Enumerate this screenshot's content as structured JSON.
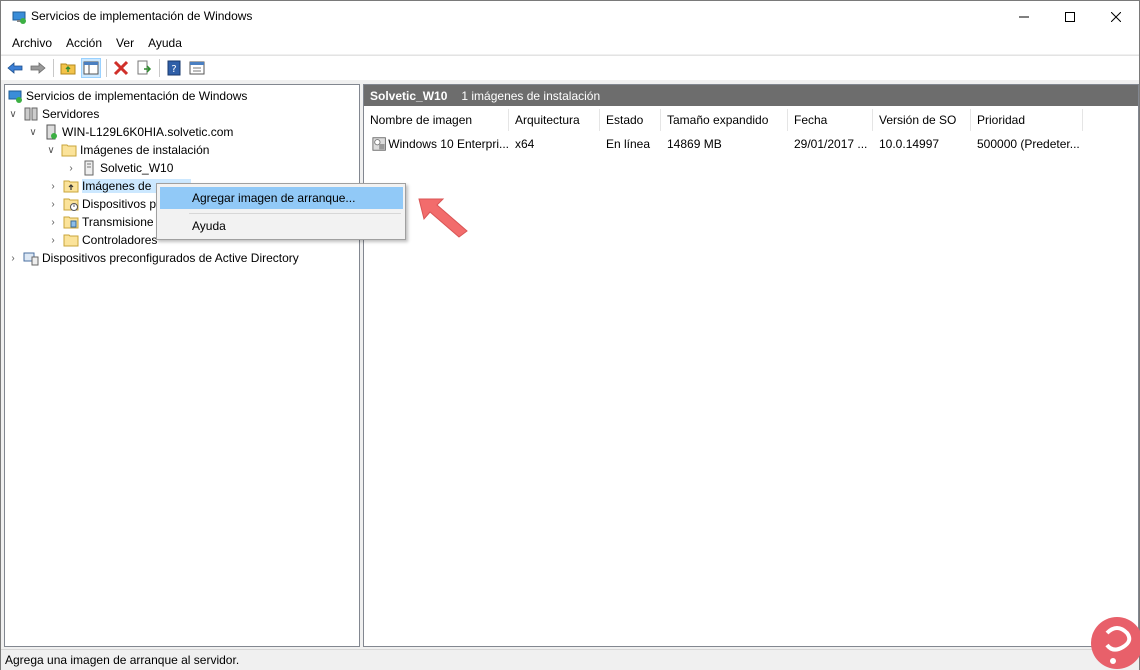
{
  "window": {
    "title": "Servicios de implementación de Windows"
  },
  "menu": [
    "Archivo",
    "Acción",
    "Ver",
    "Ayuda"
  ],
  "tree": {
    "root": "Servicios de implementación de Windows",
    "servers": "Servidores",
    "server": "WIN-L129L6K0HIA.solvetic.com",
    "install_images": "Imágenes de instalación",
    "group": "Solvetic_W10",
    "boot_images": "Imágenes de",
    "pending_devices": "Dispositivos p",
    "multicast": "Transmisione",
    "drivers": "Controladores",
    "ad_devices": "Dispositivos preconfigurados de Active Directory"
  },
  "results": {
    "group_name": "Solvetic_W10",
    "count_text": "1 imágenes de instalación",
    "columns": [
      "Nombre de imagen",
      "Arquitectura",
      "Estado",
      "Tamaño expandido",
      "Fecha",
      "Versión de SO",
      "Prioridad"
    ],
    "rows": [
      [
        "Windows 10 Enterpri...",
        "x64",
        "En línea",
        "14869 MB",
        "29/01/2017 ...",
        "10.0.14997",
        "500000 (Predeter..."
      ]
    ]
  },
  "context_menu": {
    "items": [
      "Agregar imagen de arranque...",
      "Ayuda"
    ],
    "highlighted": 0
  },
  "status": "Agrega una imagen de arranque al servidor.",
  "colors": {
    "header_strip": "#6d6d6d",
    "menu_highlight": "#91c9f7",
    "arrow": "#f26c6c",
    "logo": "#e8606a"
  }
}
